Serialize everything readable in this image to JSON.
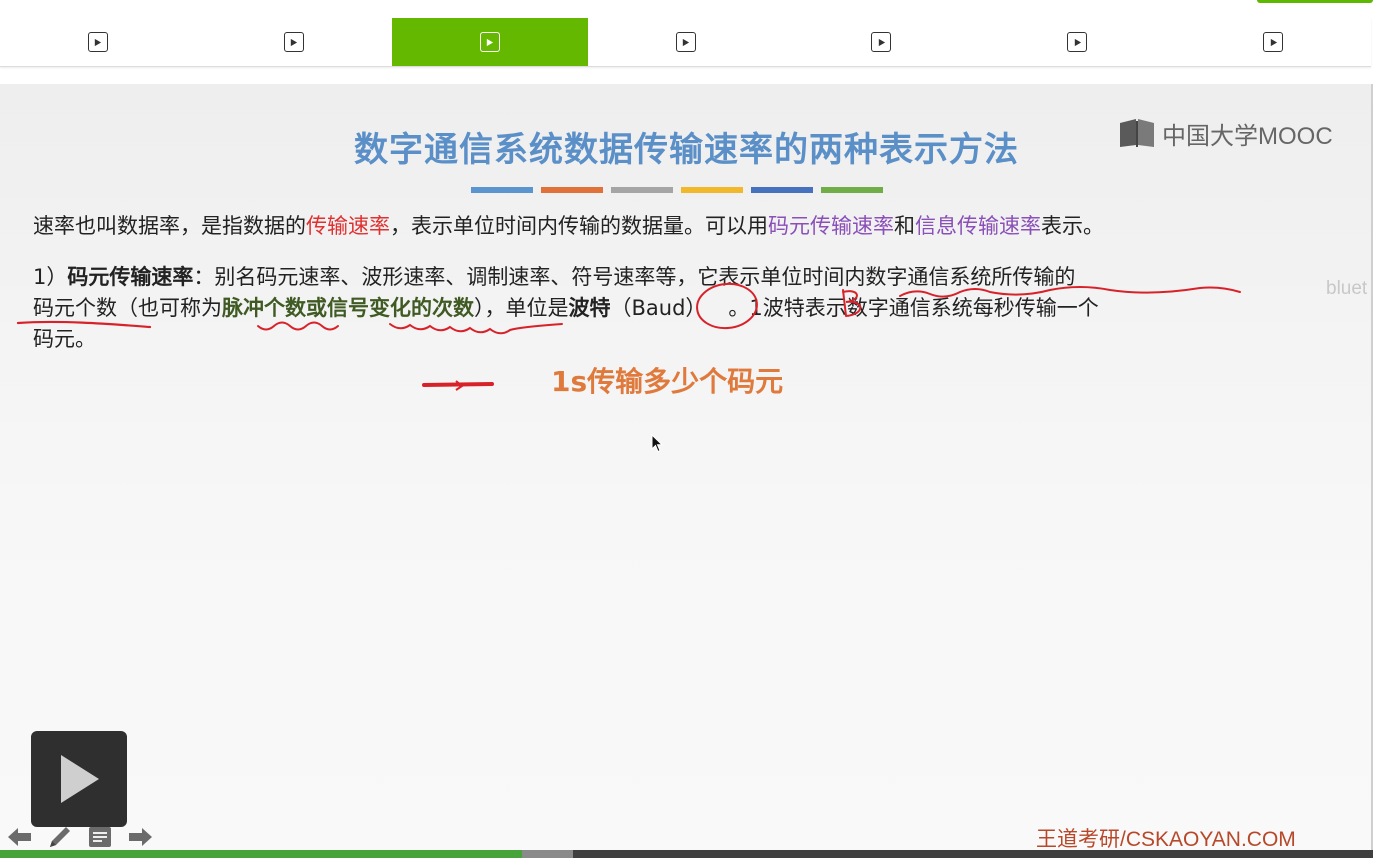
{
  "tabs": [
    {
      "label": "play-lesson-1",
      "active": false
    },
    {
      "label": "play-lesson-2",
      "active": false
    },
    {
      "label": "play-lesson-3",
      "active": true
    },
    {
      "label": "play-lesson-4",
      "active": false
    },
    {
      "label": "play-lesson-5",
      "active": false
    },
    {
      "label": "play-lesson-6",
      "active": false
    },
    {
      "label": "play-lesson-7",
      "active": false
    }
  ],
  "colors": {
    "accent_green": "#64b900",
    "title_blue": "#5a8fc8",
    "highlight_red": "#e03030",
    "highlight_purple": "#8a4fb8",
    "note_orange": "#e07a3c",
    "ink_red": "#d8222a",
    "bar_colors": [
      "#5b95cf",
      "#e07138",
      "#a5a5a5",
      "#f2b82c",
      "#4671bf",
      "#70ad47"
    ]
  },
  "slide": {
    "title": "数字通信系统数据传输速率的两种表示方法",
    "logo_text": "中国大学MOOC",
    "line1": {
      "a": "速率也叫数据率，是指数据的",
      "b": "传输速率",
      "c": "，表示单位时间内传输的数据量。可以用",
      "d": "码元传输速率",
      "e": "和",
      "f": "信息传输速率",
      "g": "表示。"
    },
    "line2": {
      "a": "1）",
      "b": "码元传输速率",
      "c": "：别名码元速率、波形速率、调制速率、符号速率等，它表示单位时间内数字通信系统所传输的"
    },
    "line3": {
      "a": "码元个数（也可称为",
      "b": "脉冲个数或信号变化的次数",
      "c": "），单位是",
      "d": "波特",
      "e": "（Baud）",
      "f": "。1波特表示数字通信系统每秒传输一个"
    },
    "line4": "码元。",
    "side_label": "bluet",
    "note": "1s传输多少个码元"
  },
  "watermark": "王道考研/CSKAOYAN.COM",
  "player": {
    "progress_played": 0.38,
    "progress_buffered_end": 0.417,
    "icons": [
      "back-arrow-icon",
      "pen-icon",
      "notes-icon",
      "forward-arrow-icon"
    ]
  }
}
